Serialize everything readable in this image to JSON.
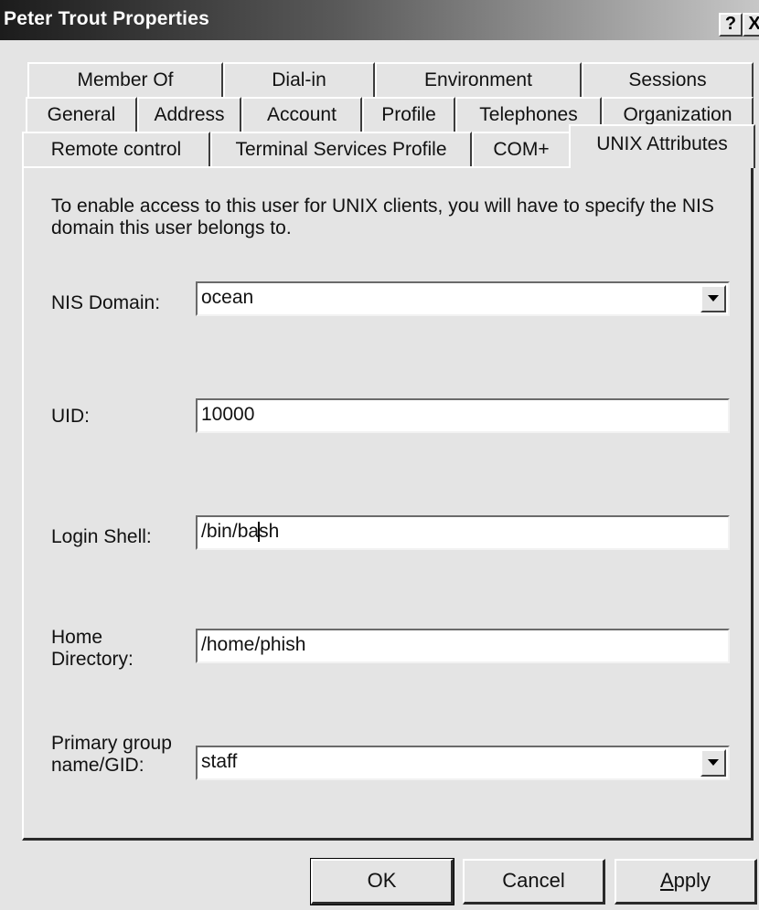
{
  "window": {
    "title": "Peter Trout Properties",
    "help_label": "?",
    "close_label": "X"
  },
  "tabs": {
    "row1": [
      "Member Of",
      "Dial-in",
      "Environment",
      "Sessions"
    ],
    "row2": [
      "General",
      "Address",
      "Account",
      "Profile",
      "Telephones",
      "Organization"
    ],
    "row3": [
      "Remote control",
      "Terminal Services Profile",
      "COM+",
      "UNIX Attributes"
    ],
    "active": "UNIX Attributes"
  },
  "panel": {
    "intro": "To enable access to this user for UNIX clients, you will have to specify the NIS domain this user belongs to.",
    "nis_domain_label": "NIS Domain:",
    "nis_domain_value": "ocean",
    "uid_label": "UID:",
    "uid_value": "10000",
    "login_shell_label": "Login Shell:",
    "login_shell_before_caret": "/bin/ba",
    "login_shell_after_caret": "sh",
    "home_dir_label_line1": "Home",
    "home_dir_label_line2": "Directory:",
    "home_dir_value": "/home/phish",
    "primary_group_label_line1": "Primary group",
    "primary_group_label_line2": "name/GID:",
    "primary_group_value": "staff"
  },
  "buttons": {
    "ok": "OK",
    "cancel": "Cancel",
    "apply_first": "A",
    "apply_rest": "pply"
  }
}
